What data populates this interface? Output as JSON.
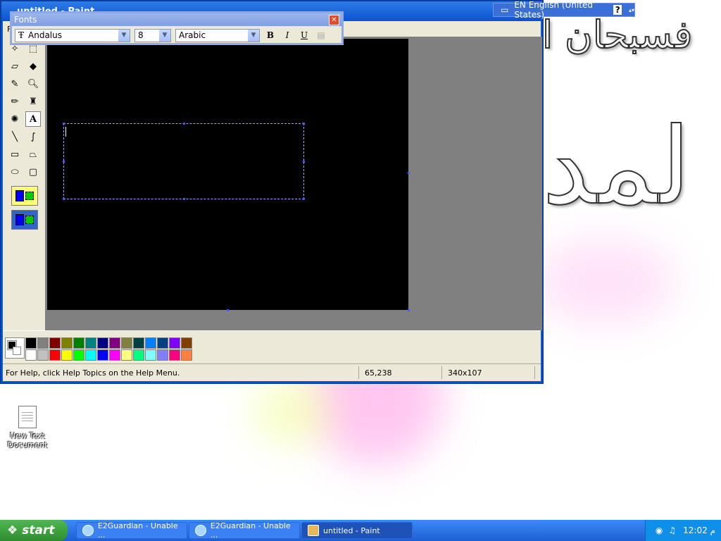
{
  "desktop": {
    "arabic_line1": "فسبحان ا",
    "arabic_line2": "لمد",
    "icon_label": "New Text Document"
  },
  "paint": {
    "title": "untitled - Paint",
    "menu_first": "F",
    "status": {
      "help": "For Help, click Help Topics on the Help Menu.",
      "coords": "65,238",
      "size": "340x107"
    },
    "palette_top": [
      "#000000",
      "#808080",
      "#800000",
      "#808000",
      "#008000",
      "#008080",
      "#000080",
      "#800080",
      "#808040",
      "#004040",
      "#0080ff",
      "#004080",
      "#8000ff",
      "#804000"
    ],
    "palette_bottom": [
      "#ffffff",
      "#c0c0c0",
      "#ff0000",
      "#ffff00",
      "#00ff00",
      "#00ffff",
      "#0000ff",
      "#ff00ff",
      "#ffff80",
      "#00ff80",
      "#80ffff",
      "#8080ff",
      "#ff0080",
      "#ff8040"
    ]
  },
  "fonts_toolbar": {
    "title": "Fonts",
    "font_name": "Andalus",
    "font_size": "8",
    "script": "Arabic",
    "bold": "B",
    "italic": "I",
    "underline": "U"
  },
  "langbar": {
    "language": "EN English (United States)",
    "help": "?"
  },
  "taskbar": {
    "start": "start",
    "items": [
      {
        "label": "E2Guardian - Unable ..."
      },
      {
        "label": "E2Guardian - Unable ..."
      },
      {
        "label": "untitled - Paint"
      }
    ],
    "clock": "12:02 م"
  }
}
